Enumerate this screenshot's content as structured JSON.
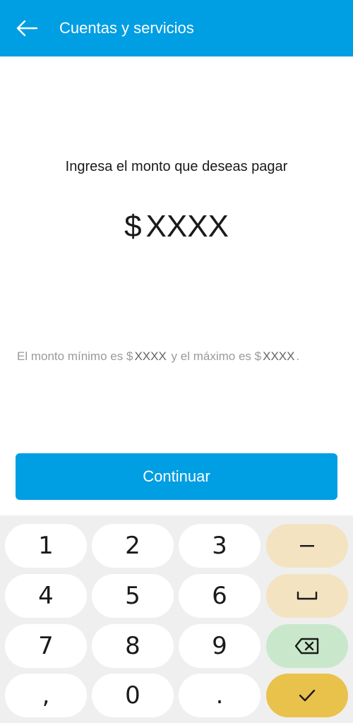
{
  "appbar": {
    "title": "Cuentas y servicios",
    "back_icon": "arrow-left-icon",
    "color": "#009EE3"
  },
  "main": {
    "prompt": "Ingresa el monto que deseas pagar",
    "amount": {
      "currency": "$",
      "value": "XXXX"
    },
    "hint": {
      "prefix": "El monto mínimo es",
      "min_currency": "$",
      "min_value": "XXXX",
      "middle": "y el máximo es",
      "max_currency": "$",
      "max_value": "XXXX",
      "suffix": "."
    }
  },
  "continue_button": {
    "label": "Continuar"
  },
  "keyboard": {
    "keys": {
      "k1": "1",
      "k2": "2",
      "k3": "3",
      "k4": "4",
      "k5": "5",
      "k6": "6",
      "k7": "7",
      "k8": "8",
      "k9": "9",
      "comma": ",",
      "k0": "0",
      "period": "."
    },
    "function_keys": {
      "minus": "minus-icon",
      "space": "space-icon",
      "backspace": "backspace-icon",
      "done": "checkmark-icon"
    },
    "colors": {
      "background": "#EFEFEF",
      "function": "#F3E3C0",
      "backspace": "#C9E8CB",
      "done": "#E9C24C"
    }
  }
}
